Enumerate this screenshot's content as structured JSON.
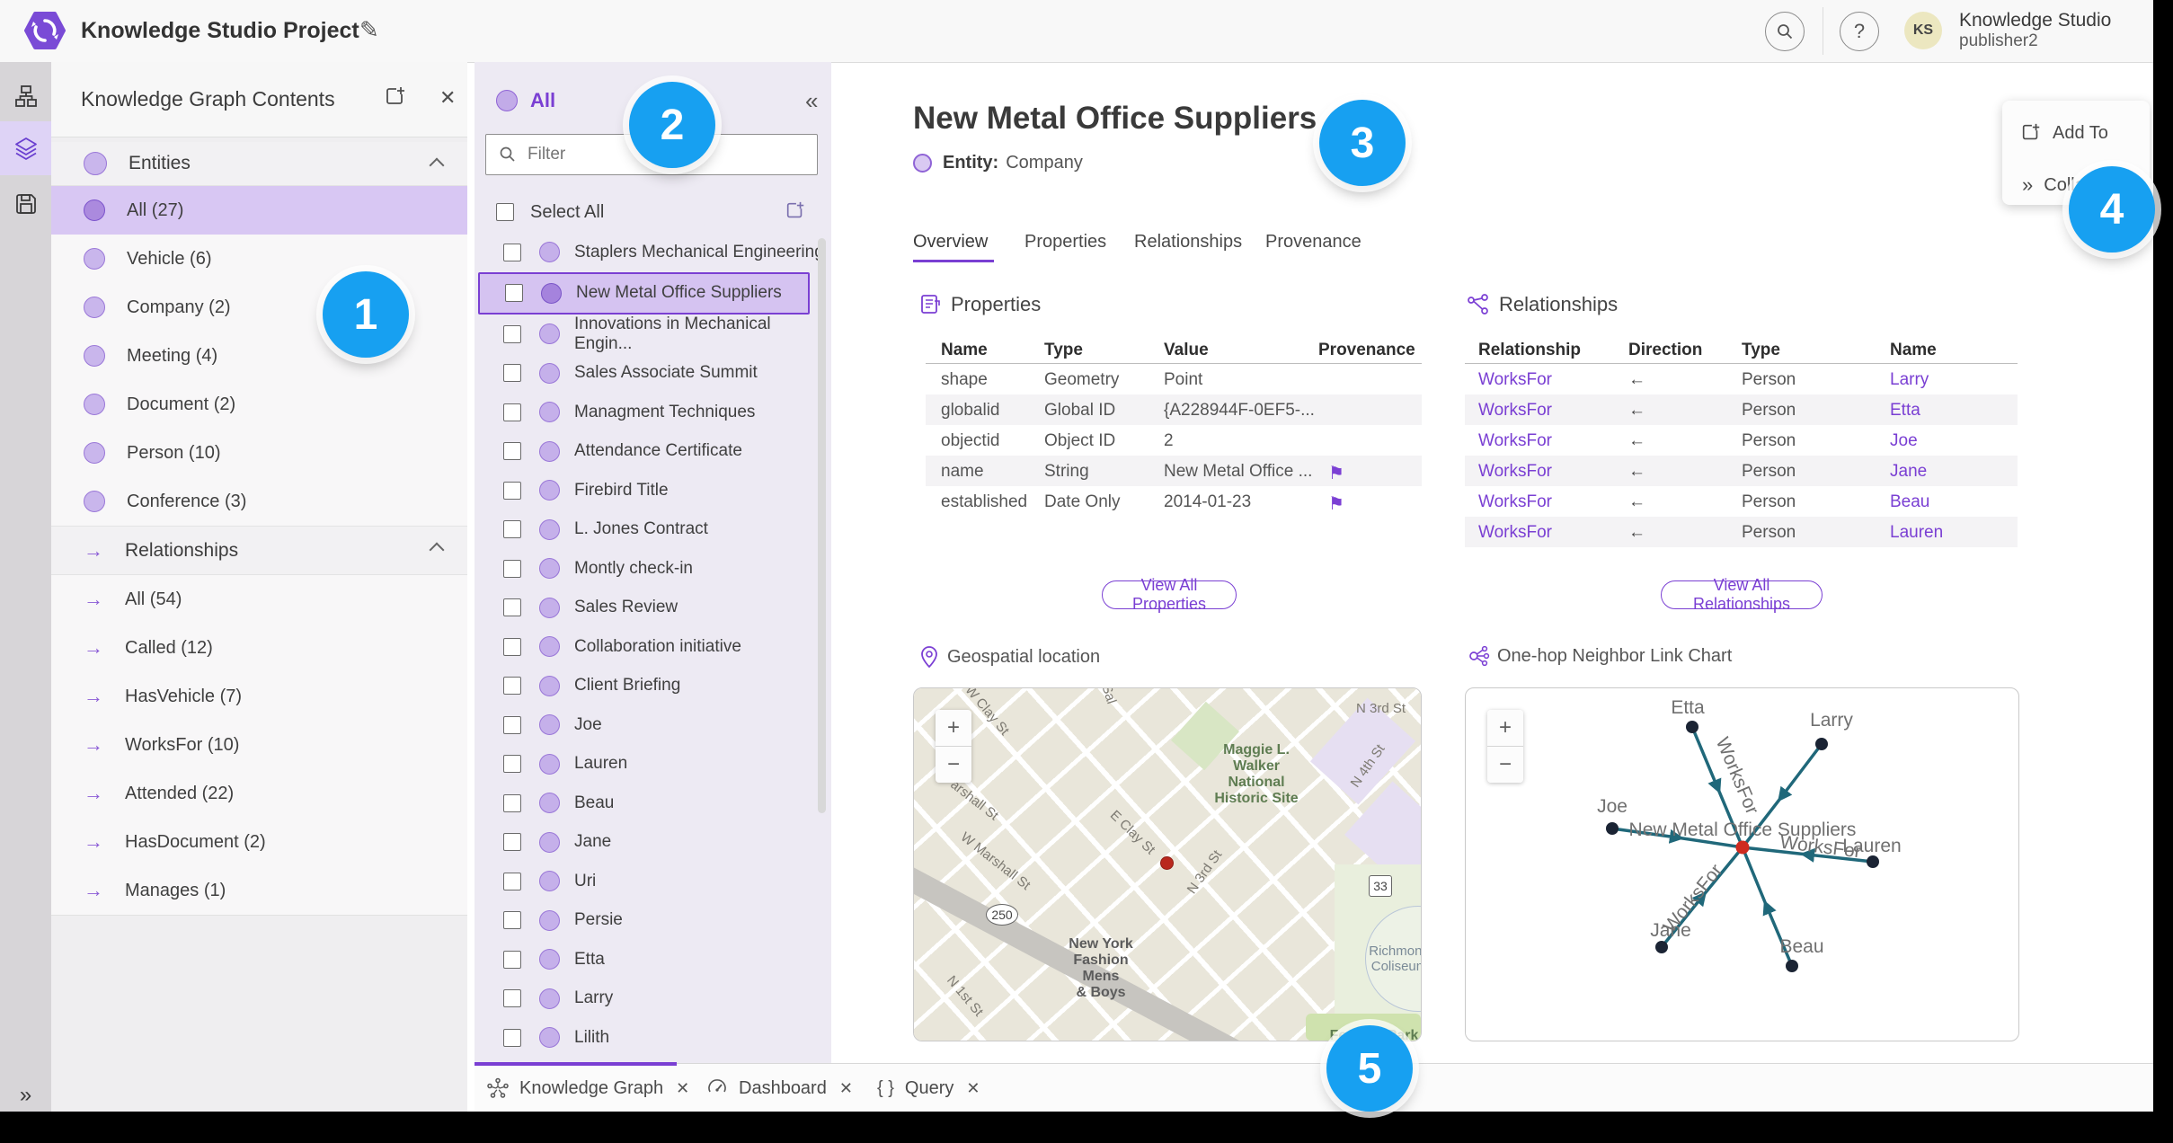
{
  "header": {
    "title": "Knowledge Studio Project",
    "avatar_initials": "KS",
    "user_name": "Knowledge Studio",
    "user_role": "publisher2"
  },
  "contents_panel": {
    "title": "Knowledge Graph Contents",
    "entities_header": "Entities",
    "arrow_glyph": "→",
    "entities": [
      {
        "label": "All (27)",
        "selected": true
      },
      {
        "label": "Vehicle (6)"
      },
      {
        "label": "Company (2)"
      },
      {
        "label": "Meeting (4)"
      },
      {
        "label": "Document (2)"
      },
      {
        "label": "Person (10)"
      },
      {
        "label": "Conference (3)"
      }
    ],
    "relationships_header": "Relationships",
    "relationships": [
      {
        "label": "All (54)"
      },
      {
        "label": "Called (12)"
      },
      {
        "label": "HasVehicle (7)"
      },
      {
        "label": "WorksFor (10)"
      },
      {
        "label": "Attended (22)"
      },
      {
        "label": "HasDocument (2)"
      },
      {
        "label": "Manages (1)"
      }
    ]
  },
  "type_panel": {
    "header": "All",
    "collapse_glyph": "«",
    "filter_placeholder": "Filter",
    "select_all": "Select All",
    "items": [
      {
        "label": "Staplers Mechanical Engineering"
      },
      {
        "label": "New Metal Office Suppliers",
        "selected": true
      },
      {
        "label": "Innovations in Mechanical Engin..."
      },
      {
        "label": "Sales Associate Summit"
      },
      {
        "label": "Managment Techniques"
      },
      {
        "label": "Attendance Certificate"
      },
      {
        "label": "Firebird Title"
      },
      {
        "label": "L. Jones Contract"
      },
      {
        "label": "Montly check-in"
      },
      {
        "label": "Sales Review"
      },
      {
        "label": "Collaboration initiative"
      },
      {
        "label": "Client Briefing"
      },
      {
        "label": "Joe"
      },
      {
        "label": "Lauren"
      },
      {
        "label": "Beau"
      },
      {
        "label": "Jane"
      },
      {
        "label": "Uri"
      },
      {
        "label": "Persie"
      },
      {
        "label": "Etta"
      },
      {
        "label": "Larry"
      },
      {
        "label": "Lilith"
      }
    ]
  },
  "detail": {
    "title": "New Metal Office Suppliers",
    "entity_label": "Entity:",
    "entity_type": "Company",
    "tabs": [
      {
        "label": "Overview",
        "active": true
      },
      {
        "label": "Properties"
      },
      {
        "label": "Relationships"
      },
      {
        "label": "Provenance"
      }
    ],
    "properties": {
      "heading": "Properties",
      "columns": [
        "Name",
        "Type",
        "Value",
        "Provenance"
      ],
      "rows": [
        {
          "name": "shape",
          "type": "Geometry",
          "value": "Point",
          "flag": ""
        },
        {
          "name": "globalid",
          "type": "Global ID",
          "value": "{A228944F-0EF5-...",
          "flag": ""
        },
        {
          "name": "objectid",
          "type": "Object ID",
          "value": "2",
          "flag": ""
        },
        {
          "name": "name",
          "type": "String",
          "value": "New Metal Office ...",
          "flag": "⚑"
        },
        {
          "name": "established",
          "type": "Date Only",
          "value": "2014-01-23",
          "flag": "⚑"
        }
      ],
      "view_all": "View All Properties"
    },
    "relationships": {
      "heading": "Relationships",
      "columns": [
        "Relationship",
        "Direction",
        "Type",
        "Name"
      ],
      "rows": [
        {
          "relationship": "WorksFor",
          "direction": "←",
          "type": "Person",
          "name": "Larry"
        },
        {
          "relationship": "WorksFor",
          "direction": "←",
          "type": "Person",
          "name": "Etta"
        },
        {
          "relationship": "WorksFor",
          "direction": "←",
          "type": "Person",
          "name": "Joe"
        },
        {
          "relationship": "WorksFor",
          "direction": "←",
          "type": "Person",
          "name": "Jane"
        },
        {
          "relationship": "WorksFor",
          "direction": "←",
          "type": "Person",
          "name": "Beau"
        },
        {
          "relationship": "WorksFor",
          "direction": "←",
          "type": "Person",
          "name": "Lauren"
        }
      ],
      "view_all": "View All Relationships"
    },
    "map": {
      "heading": "Geospatial location",
      "zoom_in": "+",
      "zoom_out": "−",
      "labels": {
        "w_clay": "W Clay St",
        "sal": "Sal",
        "n3rd_top": "N 3rd St",
        "n4th": "N 4th St",
        "maggie": "Maggie L.\nWalker National\nHistoric Site",
        "marshall": "arshall St",
        "e_clay": "E Clay St",
        "w_marshall": "W Marshall St",
        "nyfashion": "New York\nFashion Mens\n& Boys",
        "n3rd_mid": "N 3rd St",
        "n1st": "N 1st St",
        "richmond": "Richmond\nColiseum",
        "festival": "Festival Park",
        "shield_250": "250",
        "shield_33": "33"
      }
    },
    "link_chart": {
      "heading": "One-hop Neighbor Link Chart",
      "zoom_in": "+",
      "zoom_out": "−",
      "center_label": "New Metal Office Suppliers",
      "edge_label": "WorksFor",
      "nodes": [
        "Etta",
        "Larry",
        "Joe",
        "Lauren",
        "Jane",
        "Beau"
      ]
    }
  },
  "popup": {
    "items": [
      {
        "label": "Add To"
      },
      {
        "label": "Colla"
      }
    ]
  },
  "tab_bar": {
    "close_glyph": "✕",
    "tabs": [
      {
        "label": "Knowledge Graph",
        "active": true
      },
      {
        "label": "Dashboard"
      },
      {
        "label": "Query"
      }
    ]
  },
  "annotations": [
    "1",
    "2",
    "3",
    "4",
    "5"
  ],
  "colors": {
    "accent": "#7a3fd3",
    "selection_bg": "#d8c7f3",
    "annotation_blue": "#17a0f1",
    "edge_teal": "#20687a",
    "node_navy": "#1b2434",
    "center_red": "#cf2b20"
  }
}
